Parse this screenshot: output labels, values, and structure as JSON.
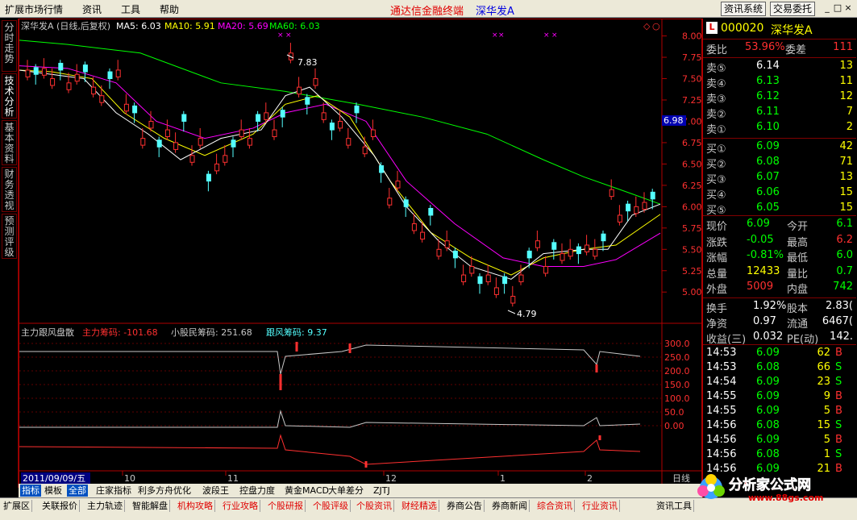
{
  "menu": [
    "扩展市场行情",
    "资讯",
    "工具",
    "帮助"
  ],
  "app_title": "通达信金融终端",
  "stock_title": "深华发A",
  "top_buttons": [
    "资讯系统",
    "交易委托"
  ],
  "window_controls": [
    "_",
    "□",
    "×"
  ],
  "side_tabs": [
    "分时走势",
    "技术分析",
    "基本资料",
    "财务透视",
    "预测评级"
  ],
  "chart_header": {
    "name": "深华发A (日线,后复权)",
    "ma5": "MA5: 6.03",
    "ma10": "MA10: 5.91",
    "ma20": "MA20: 5.69",
    "ma60": "MA60: 6.03"
  },
  "price_axis": [
    "8.00",
    "7.75",
    "7.50",
    "7.25",
    "7.00",
    "6.75",
    "6.50",
    "6.25",
    "6.00",
    "5.75",
    "5.50",
    "5.25",
    "5.00"
  ],
  "current_price_tag": "6.98",
  "high_label": "7.83",
  "low_label": "4.79",
  "indicator_header": {
    "name": "主力跟风盘散",
    "main": "主力筹码: -101.68",
    "retail": "小股民筹码: 251.68",
    "follow": "跟风筹码: 9.37"
  },
  "indicator_axis": [
    "300.0",
    "250.0",
    "200.0",
    "150.0",
    "100.0",
    "50.0",
    "0.00"
  ],
  "date_axis": {
    "start": "2011/09/09/五",
    "months": [
      "10",
      "11",
      "12",
      "1",
      "2"
    ],
    "period": "日线"
  },
  "chart_data": {
    "type": "candlestick",
    "title": "深华发A (日线,后复权)",
    "ylim": [
      4.7,
      8.1
    ],
    "series_ma": [
      "MA5",
      "MA10",
      "MA20",
      "MA60"
    ],
    "colors": {
      "up": "#ff3030",
      "down": "#54ffff",
      "ma5": "#ffffff",
      "ma10": "#ffff00",
      "ma20": "#ff00ff",
      "ma60": "#00ff00"
    },
    "high": 7.83,
    "low": 4.79
  },
  "quote": {
    "code": "000020",
    "name": "深华发A",
    "webi_label": "委比",
    "webi": "53.96%",
    "weicha_label": "委差",
    "weicha": "111",
    "sells": [
      {
        "label": "卖⑤",
        "price": "6.14",
        "vol": "13"
      },
      {
        "label": "卖④",
        "price": "6.13",
        "vol": "11"
      },
      {
        "label": "卖③",
        "price": "6.12",
        "vol": "12"
      },
      {
        "label": "卖②",
        "price": "6.11",
        "vol": "7"
      },
      {
        "label": "卖①",
        "price": "6.10",
        "vol": "2"
      }
    ],
    "buys": [
      {
        "label": "买①",
        "price": "6.09",
        "vol": "42"
      },
      {
        "label": "买②",
        "price": "6.08",
        "vol": "71"
      },
      {
        "label": "买③",
        "price": "6.07",
        "vol": "13"
      },
      {
        "label": "买④",
        "price": "6.06",
        "vol": "15"
      },
      {
        "label": "买⑤",
        "price": "6.05",
        "vol": "15"
      }
    ],
    "stats": [
      {
        "l1": "现价",
        "v1": "6.09",
        "l2": "今开",
        "v2": "6.1"
      },
      {
        "l1": "涨跌",
        "v1": "-0.05",
        "l2": "最高",
        "v2": "6.2"
      },
      {
        "l1": "涨幅",
        "v1": "-0.81%",
        "l2": "最低",
        "v2": "6.0"
      },
      {
        "l1": "总量",
        "v1": "12433",
        "l2": "量比",
        "v2": "0.7"
      },
      {
        "l1": "外盘",
        "v1": "5009",
        "l2": "内盘",
        "v2": "742"
      }
    ],
    "stats2": [
      {
        "l1": "换手",
        "v1": "1.92%",
        "l2": "股本",
        "v2": "2.83("
      },
      {
        "l1": "净资",
        "v1": "0.97",
        "l2": "流通",
        "v2": "6467("
      },
      {
        "l1": "收益(三)",
        "v1": "0.032",
        "l2": "PE(动)",
        "v2": "142."
      }
    ],
    "ticks": [
      {
        "t": "14:53",
        "p": "6.09",
        "v": "62",
        "s": "B"
      },
      {
        "t": "14:53",
        "p": "6.08",
        "v": "66",
        "s": "S"
      },
      {
        "t": "14:54",
        "p": "6.09",
        "v": "23",
        "s": "S"
      },
      {
        "t": "14:55",
        "p": "6.09",
        "v": "9",
        "s": "B"
      },
      {
        "t": "14:55",
        "p": "6.09",
        "v": "5",
        "s": "B"
      },
      {
        "t": "14:56",
        "p": "6.08",
        "v": "15",
        "s": "S"
      },
      {
        "t": "14:56",
        "p": "6.09",
        "v": "5",
        "s": "B"
      },
      {
        "t": "14:56",
        "p": "6.08",
        "v": "1",
        "s": "S"
      },
      {
        "t": "14:56",
        "p": "6.09",
        "v": "21",
        "s": "B"
      }
    ]
  },
  "bottom_tabs": [
    "指标",
    "模板",
    "全部",
    "庄家指标",
    "利多方舟优化",
    "波段王",
    "控盘力度",
    "黄金MACD",
    "大单差分",
    "ZJTJ"
  ],
  "taskbar": [
    "扩展区",
    "关联报价",
    "主力轨迹",
    "智能解盘",
    "机构攻略",
    "行业攻略",
    "个股研报",
    "个股评级",
    "个股资讯",
    "财经精选",
    "券商公告",
    "券商新闻",
    "综合资讯",
    "行业资讯",
    "资讯工具"
  ],
  "logo": {
    "text": "分析家公式网",
    "url": "www.88gs.com"
  }
}
